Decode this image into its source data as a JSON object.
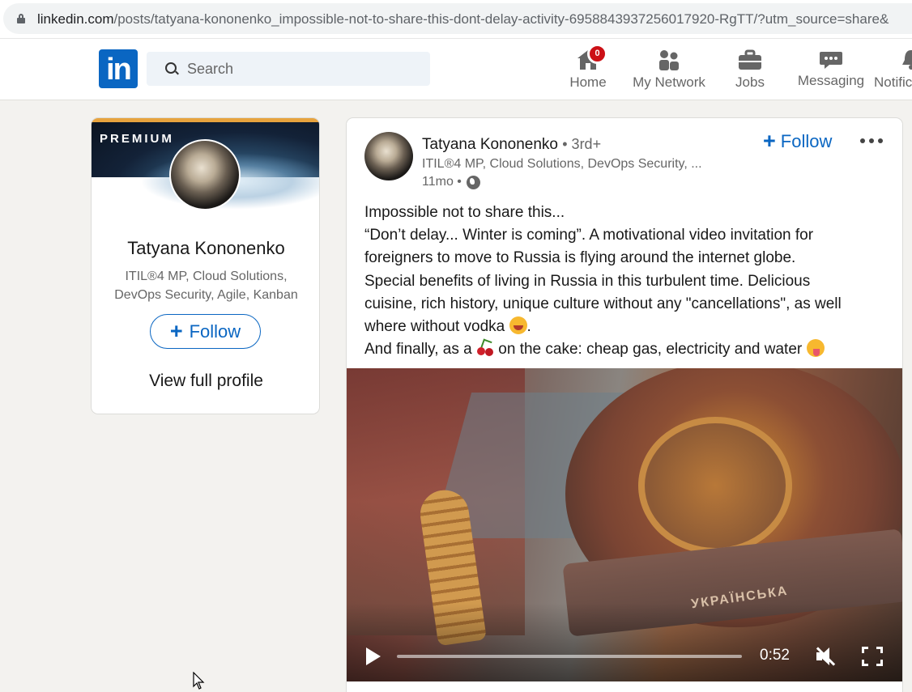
{
  "browser": {
    "url_host": "linkedin.com",
    "url_path": "/posts/tatyana-kononenko_impossible-not-to-share-this-dont-delay-activity-6958843937256017920-RgTT/?utm_source=share&"
  },
  "nav": {
    "logo_text": "in",
    "search_placeholder": "Search",
    "items": [
      {
        "label": "Home",
        "icon": "home-icon"
      },
      {
        "label": "My Network",
        "icon": "people-icon"
      },
      {
        "label": "Jobs",
        "icon": "briefcase-icon"
      },
      {
        "label": "Messaging",
        "icon": "chat-icon"
      },
      {
        "label": "Notific",
        "icon": "bell-icon"
      }
    ],
    "home_badge": "0",
    "colors": {
      "brand": "#0a66c2",
      "badge": "#cc1016"
    }
  },
  "profile": {
    "premium_label": "PREMIUM",
    "name": "Tatyana Kononenko",
    "headline_line1": "ITIL®4 MP, Cloud Solutions,",
    "headline_line2": "DevOps Security, Agile, Kanban",
    "follow_label": "Follow",
    "view_profile_label": "View full profile"
  },
  "post": {
    "author_name": "Tatyana Kononenko",
    "degree": "• 3rd+",
    "author_headline": "ITIL®4 MP, Cloud Solutions, DevOps Security, ...",
    "age": "11mo •",
    "follow_label": "Follow",
    "text": {
      "line1": "Impossible not to share this...",
      "line2": "“Don’t delay... Winter is coming”. A motivational video invitation for",
      "line3": "foreigners to move to Russia is flying around the internet globe.",
      "line4": "Special benefits of living in Russia in this turbulent time. Delicious",
      "line5": "cuisine, rich history, unique culture without any \"cancellations\", as well",
      "line6a": "where without vodka",
      "line6b": ".",
      "line7a": "And finally, as a",
      "line7b": "on the cake: cheap gas, electricity and water"
    },
    "video": {
      "time": "0:52",
      "progress": 0,
      "overlay_text": "УКРАЇНСЬКА",
      "muted": true
    }
  }
}
